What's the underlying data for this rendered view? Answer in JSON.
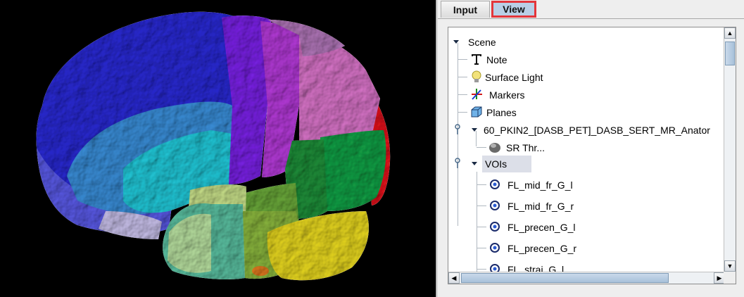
{
  "tabs": [
    {
      "label": "Input",
      "selected": false
    },
    {
      "label": "View",
      "selected": true,
      "highlight_color": "#e3363b"
    }
  ],
  "tree": {
    "root": {
      "label": "Scene",
      "expanded": true
    },
    "items": [
      {
        "label": "Note",
        "icon": "text-note-icon"
      },
      {
        "label": "Surface Light",
        "icon": "light-bulb-icon"
      },
      {
        "label": "Markers",
        "icon": "axes-markers-icon"
      },
      {
        "label": "Planes",
        "icon": "cube-planes-icon"
      },
      {
        "label": "60_PKIN2_[DASB_PET]_DASB_SERT_MR_Anator",
        "icon": "dataset-node-icon",
        "expanded": true
      },
      {
        "label": "SR Thr...",
        "icon": "surface-render-icon"
      },
      {
        "label": "VOIs",
        "icon": "folder-node-icon",
        "expanded": true,
        "selected": true
      }
    ],
    "vois": [
      {
        "label": "FL_mid_fr_G_l"
      },
      {
        "label": "FL_mid_fr_G_r"
      },
      {
        "label": "FL_precen_G_l"
      },
      {
        "label": "FL_precen_G_r"
      },
      {
        "label": "FL_strai_G_l"
      }
    ]
  },
  "colors": {
    "selection": "#dcdfe8",
    "tab_selected": "#b9cfe6",
    "scroll_thumb": "#b7cde3"
  }
}
